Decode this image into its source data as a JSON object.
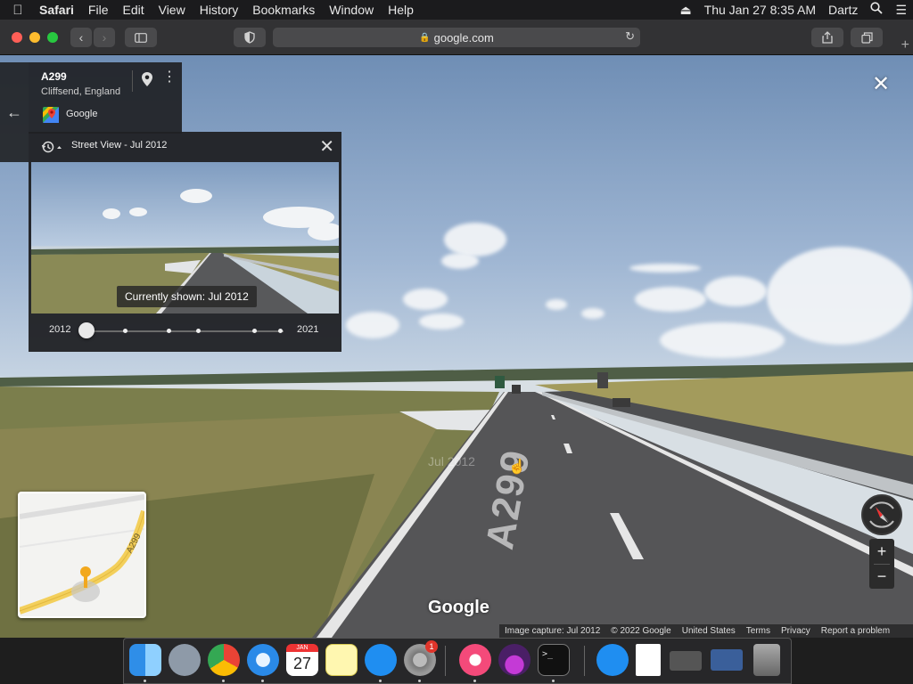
{
  "menubar": {
    "app": "Safari",
    "items": [
      "File",
      "Edit",
      "View",
      "History",
      "Bookmarks",
      "Window",
      "Help"
    ],
    "clock": "Thu Jan 27  8:35 AM",
    "user": "Dartz",
    "icons": [
      "apple-icon",
      "eject-icon",
      "search-icon",
      "menu-list-icon"
    ]
  },
  "browser": {
    "url": "google.com",
    "lock_icon": "🔒",
    "reload_glyph": "↻"
  },
  "place": {
    "title": "A299",
    "subtitle": "Cliffsend, England",
    "provider": "Google"
  },
  "timeline": {
    "title": "Street View - Jul 2012",
    "currently_shown": "Currently shown: Jul 2012",
    "start_year": "2012",
    "end_year": "2021",
    "selected_index": 0
  },
  "scene": {
    "road_marking": "A299",
    "date_watermark": "Jul 2012",
    "minimap_road_label": "A299",
    "google_watermark": "Google"
  },
  "footer": {
    "capture": "Image capture: Jul 2012",
    "copyright": "© 2022 Google",
    "region": "United States",
    "terms": "Terms",
    "privacy": "Privacy",
    "report": "Report a problem"
  },
  "zoom": {
    "in": "+",
    "out": "−"
  },
  "dock": {
    "calendar_month": "JAN",
    "calendar_day": "27",
    "system_prefs_badge": "1"
  },
  "colors": {
    "panel_bg": "#202124",
    "accent_road": "#f2c94c",
    "close_red": "#ff5f57",
    "min_yellow": "#febc2e",
    "max_green": "#28c840"
  }
}
